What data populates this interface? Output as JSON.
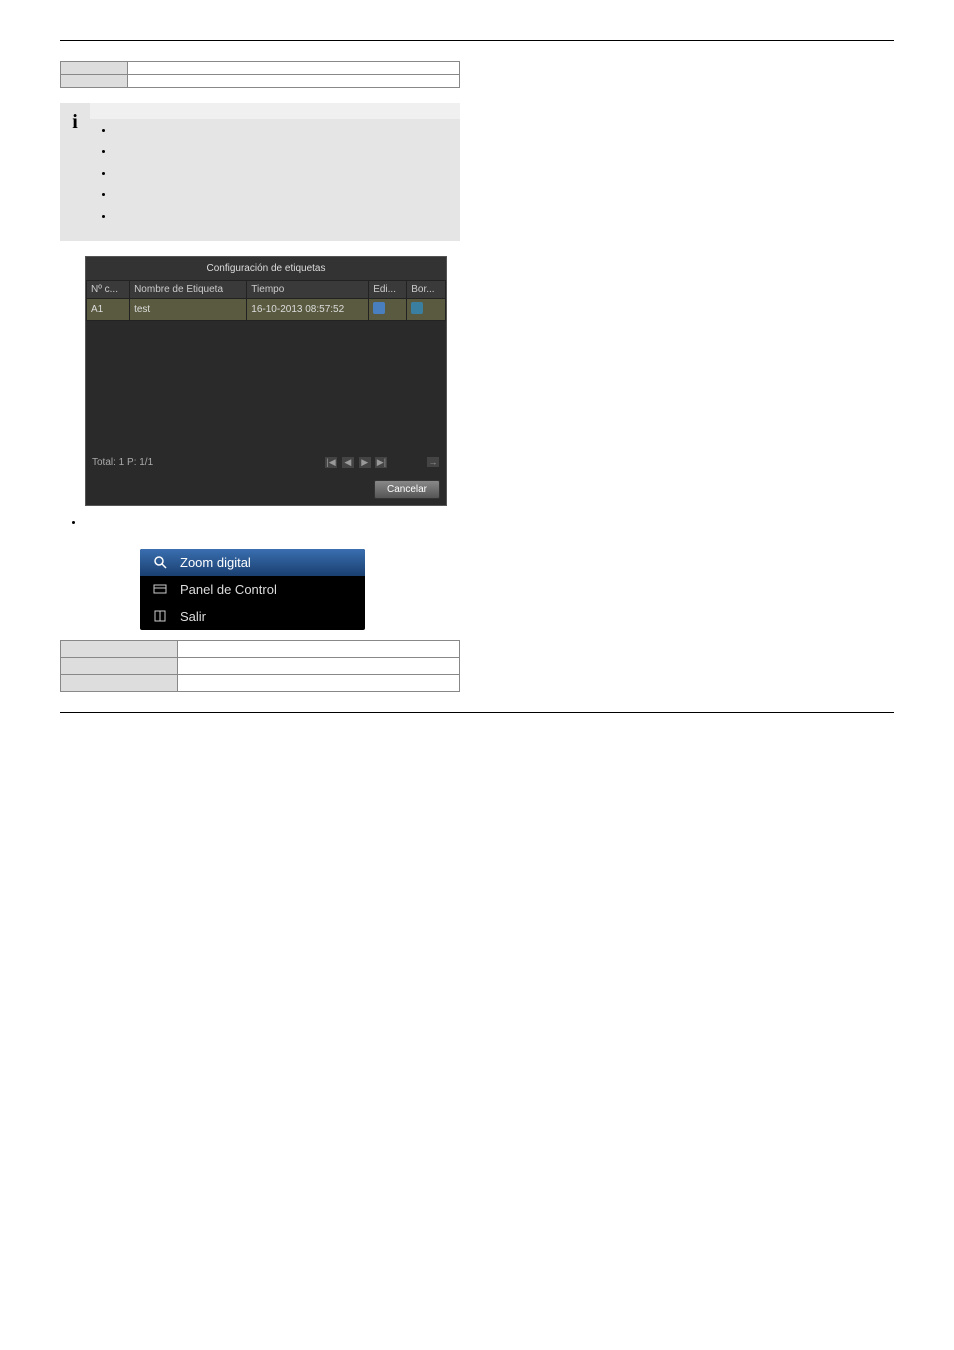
{
  "top_table": {
    "row1_left": "",
    "row1_right": "",
    "row2_left": "",
    "row2_right": ""
  },
  "note": {
    "header": "",
    "bullets": [
      "",
      "",
      "",
      "",
      ""
    ]
  },
  "tag_window": {
    "title": "Configuración de etiquetas",
    "headers": {
      "col1": "Nº c...",
      "col2": "Nombre de Etiqueta",
      "col3": "Tiempo",
      "col4": "Edi...",
      "col5": "Bor..."
    },
    "row": {
      "num": "A1",
      "name": "test",
      "time": "16-10-2013 08:57:52"
    },
    "footer_total": "Total: 1 P: 1/1",
    "paging": {
      "first": "|◀",
      "prev": "◀",
      "next": "▶",
      "last": "▶|"
    },
    "cancel": "Cancelar"
  },
  "outer_bullet": "",
  "context_menu": {
    "zoom": "Zoom digital",
    "panel": "Panel de Control",
    "exit": "Salir"
  },
  "context_table": {
    "row1_left": "",
    "row1_right": "",
    "row2_left": "",
    "row2_right": "",
    "row3_left": "",
    "row3_right": ""
  },
  "page_number": ""
}
